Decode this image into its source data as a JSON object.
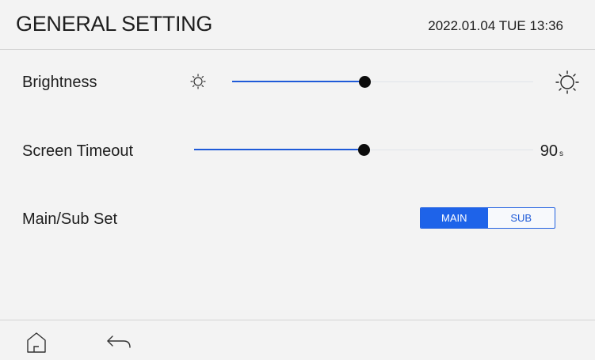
{
  "header": {
    "title": "GENERAL SETTING",
    "datetime": "2022.01.04 TUE 13:36"
  },
  "settings": {
    "brightness": {
      "label": "Brightness",
      "level_percent": 44,
      "min_icon": "sun-small-icon",
      "max_icon": "sun-large-icon"
    },
    "screen_timeout": {
      "label": "Screen Timeout",
      "level_percent": 50,
      "value": "90",
      "unit": "s"
    },
    "main_sub_set": {
      "label": "Main/Sub Set",
      "options": [
        "MAIN",
        "SUB"
      ],
      "selected": "MAIN"
    }
  },
  "footer": {
    "home_icon": "home-icon",
    "back_icon": "back-arrow-icon"
  },
  "colors": {
    "accent": "#1e63e9",
    "thumb": "#0c0c0c",
    "background": "#f3f3f3"
  }
}
